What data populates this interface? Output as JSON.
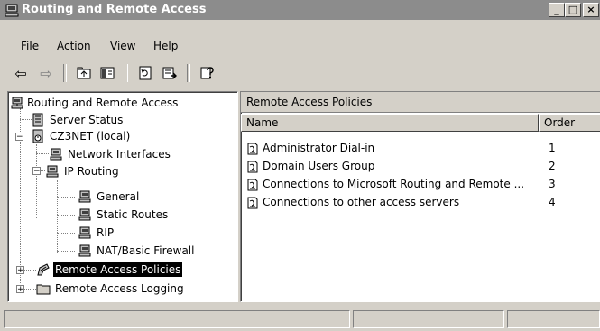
{
  "window": {
    "title": "Routing and Remote Access",
    "min_glyph": "_",
    "max_glyph": "□",
    "close_glyph": "×"
  },
  "menu": {
    "items": [
      {
        "label": "File",
        "hot": "F",
        "rest": "ile"
      },
      {
        "label": "Action",
        "hot": "A",
        "rest": "ction"
      },
      {
        "label": "View",
        "hot": "V",
        "rest": "iew"
      },
      {
        "label": "Help",
        "hot": "H",
        "rest": "elp"
      }
    ]
  },
  "toolbar": {
    "back_glyph": "⇦",
    "forward_glyph": "⇨"
  },
  "tree": {
    "root": "Routing and Remote Access",
    "server_status": "Server Status",
    "server": "CZ3NET (local)",
    "network_interfaces": "Network Interfaces",
    "ip_routing": "IP Routing",
    "general": "General",
    "static_routes": "Static Routes",
    "rip": "RIP",
    "nat": "NAT/Basic Firewall",
    "remote_access_policies": "Remote Access Policies",
    "remote_access_logging": "Remote Access Logging",
    "expand_minus": "−",
    "expand_plus": "+"
  },
  "details": {
    "header": "Remote Access Policies",
    "columns": {
      "name": "Name",
      "order": "Order"
    },
    "rows": [
      {
        "name": "Administrator Dial-in",
        "order": "1"
      },
      {
        "name": "Domain Users Group",
        "order": "2"
      },
      {
        "name": "Connections to Microsoft Routing and Remote ...",
        "order": "3"
      },
      {
        "name": "Connections to other access servers",
        "order": "4"
      }
    ]
  },
  "colors": {
    "titlebar": "#8c8c8c",
    "face": "#d4d0c8",
    "selection": "#000000"
  }
}
